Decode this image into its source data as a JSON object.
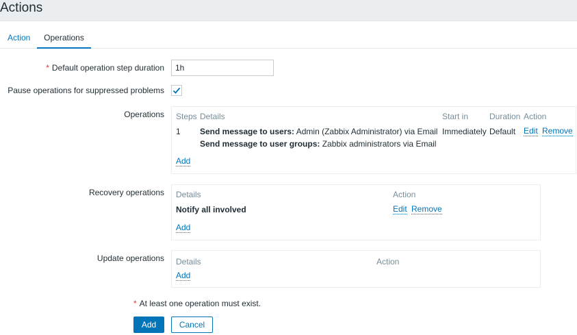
{
  "page": {
    "title": "Actions"
  },
  "tabs": [
    {
      "label": "Action"
    },
    {
      "label": "Operations"
    }
  ],
  "form": {
    "step_duration_label": "Default operation step duration",
    "step_duration_value": "1h",
    "pause_label": "Pause operations for suppressed problems",
    "pause_checked": true,
    "operations_label": "Operations",
    "recovery_label": "Recovery operations",
    "update_label": "Update operations",
    "required_note": "At least one operation must exist."
  },
  "operations": {
    "headers": {
      "steps": "Steps",
      "details": "Details",
      "start_in": "Start in",
      "duration": "Duration",
      "action": "Action"
    },
    "rows": [
      {
        "step": "1",
        "line1_bold": "Send message to users:",
        "line1_rest": " Admin (Zabbix Administrator) via Email",
        "line2_bold": "Send message to user groups:",
        "line2_rest": " Zabbix administrators via Email",
        "start_in": "Immediately",
        "duration": "Default",
        "edit": "Edit",
        "remove": "Remove"
      }
    ],
    "add": "Add"
  },
  "recovery": {
    "headers": {
      "details": "Details",
      "action": "Action"
    },
    "rows": [
      {
        "details": "Notify all involved",
        "edit": "Edit",
        "remove": "Remove"
      }
    ],
    "add": "Add"
  },
  "update": {
    "headers": {
      "details": "Details",
      "action": "Action"
    },
    "add": "Add"
  },
  "buttons": {
    "add": "Add",
    "cancel": "Cancel"
  },
  "colors": {
    "accent": "#0275b8",
    "required": "#e33734",
    "header_bg": "#ebeef0"
  }
}
